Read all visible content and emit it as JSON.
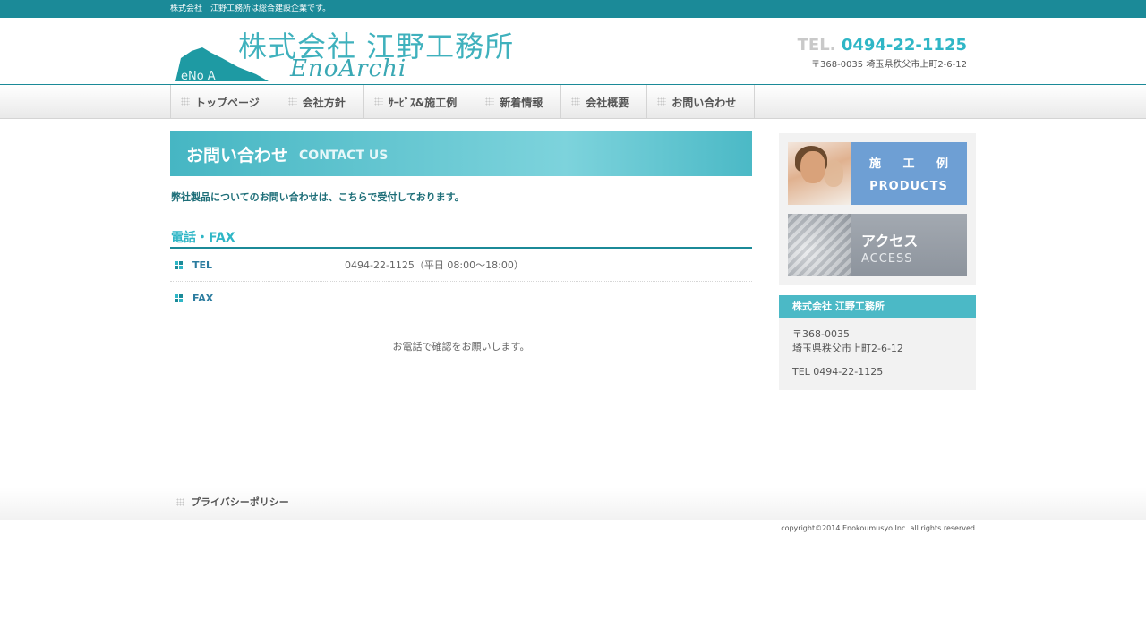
{
  "topbar": {
    "tagline": "株式会社　江野工務所は総合建設企業です。"
  },
  "header": {
    "logo_jp": "株式会社 江野工務所",
    "logo_en": "EnoArchi",
    "logo_mark_text": "eNo A",
    "tel_label": "TEL.",
    "tel_number": "0494-22-1125",
    "address": "〒368-0035 埼玉県秩父市上町2-6-12"
  },
  "nav": {
    "items": [
      {
        "label": "トップページ"
      },
      {
        "label": "会社方針"
      },
      {
        "label": "ｻｰﾋﾞｽ&施工例"
      },
      {
        "label": "新着情報"
      },
      {
        "label": "会社概要"
      },
      {
        "label": "お問い合わせ"
      }
    ]
  },
  "main": {
    "heading_jp": "お問い合わせ",
    "heading_en": "CONTACT US",
    "lead": "弊社製品についてのお問い合わせは、こちらで受付しております。",
    "section_title": "電話・FAX",
    "rows": [
      {
        "key": "TEL",
        "value": "0494-22-1125（平日 08:00～18:00）"
      },
      {
        "key": "FAX",
        "value": ""
      }
    ],
    "note": "お電話で確認をお願いします。"
  },
  "sidebar": {
    "banner_products": {
      "jp": "施 工 例",
      "en": "PRODUCTS"
    },
    "banner_access": {
      "jp": "アクセス",
      "en": "ACCESS"
    },
    "company": {
      "title": "株式会社 江野工務所",
      "postal": "〒368-0035",
      "address": "埼玉県秩父市上町2-6-12",
      "tel": "TEL 0494-22-1125"
    }
  },
  "footer": {
    "privacy": "プライバシーポリシー",
    "copyright": "copyright©2014 Enokoumusyo Inc. all rights reserved"
  },
  "colors": {
    "teal_dark": "#1b8a98",
    "teal_accent": "#2fb6c6",
    "products_blue": "#6e9fd4",
    "access_gray": "#8d949d"
  }
}
